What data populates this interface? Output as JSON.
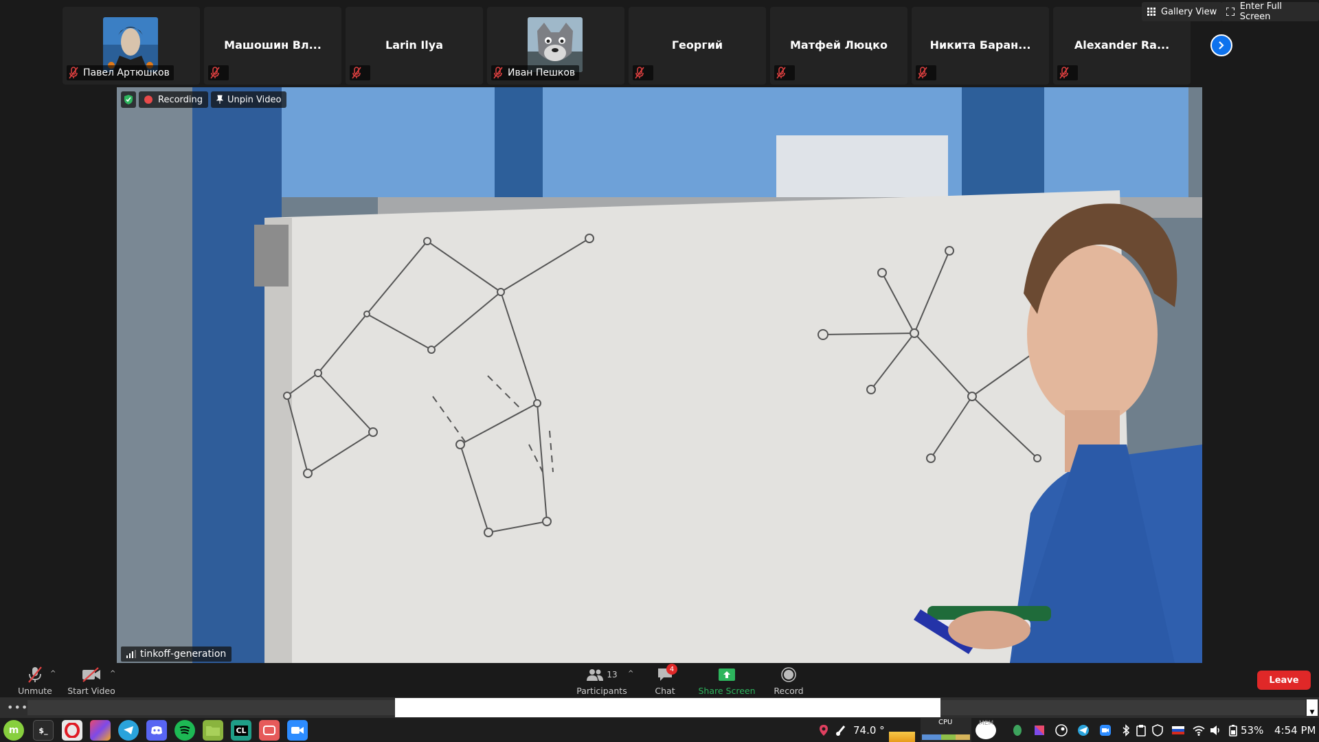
{
  "participants": [
    {
      "name": "Павел Артюшков",
      "has_avatar": true
    },
    {
      "name": "Машошин Вл..."
    },
    {
      "name": "Larin Ilya"
    },
    {
      "name": "Иван Пешков",
      "has_avatar": true
    },
    {
      "name": "Георгий"
    },
    {
      "name": "Матфей Люцко"
    },
    {
      "name": "Никита Баран..."
    },
    {
      "name": "Alexander Ra..."
    }
  ],
  "top_controls": {
    "gallery_view": "Gallery View",
    "full_screen": "Enter Full Screen"
  },
  "video": {
    "recording_label": "Recording",
    "unpin_label": "Unpin Video",
    "speaker_name": "tinkoff-generation"
  },
  "toolbar": {
    "unmute": "Unmute",
    "start_video": "Start Video",
    "participants_label": "Participants",
    "participants_count": "13",
    "chat_label": "Chat",
    "chat_badge": "4",
    "share_screen": "Share Screen",
    "record": "Record",
    "leave": "Leave"
  },
  "taskbar": {
    "temperature": "74.0 °",
    "cpu_label": "CPU",
    "mem_label": "MEM",
    "battery": "53%",
    "clock": "4:54 PM"
  },
  "colors": {
    "accent_blue": "#0e72ed",
    "leave_red": "#e02828",
    "share_green": "#2db55d"
  }
}
